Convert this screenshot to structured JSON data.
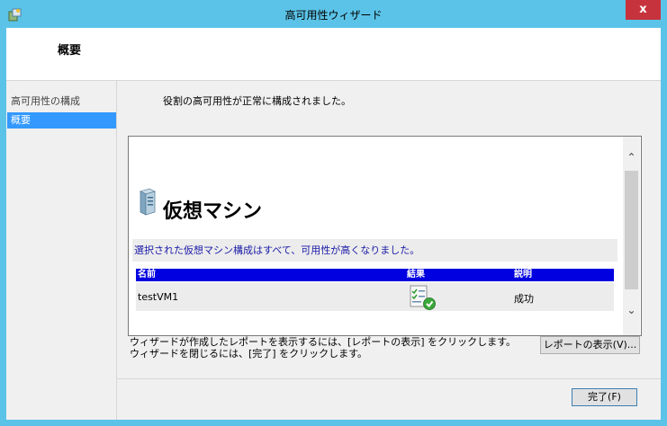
{
  "window": {
    "title": "高可用性ウィザード",
    "close_label": "x"
  },
  "header": {
    "title": "概要"
  },
  "sidebar": {
    "items": [
      {
        "label": "高可用性の構成"
      },
      {
        "label": "概要"
      }
    ]
  },
  "main": {
    "status_message": "役割の高可用性が正常に構成されました。",
    "report": {
      "heading": "仮想マシン",
      "summary": "選択された仮想マシン構成はすべて、可用性が高くなりました。",
      "columns": [
        "名前",
        "結果",
        "説明"
      ],
      "rows": [
        {
          "name": "testVM1",
          "result_icon": "success-check-icon",
          "description": "成功"
        }
      ]
    },
    "footer_text_line1": "ウィザードが作成したレポートを表示するには、[レポートの表示] をクリックします。",
    "footer_text_line2": "ウィザードを閉じるには、[完了] をクリックします。",
    "view_report_button": "レポートの表示(V)...",
    "finish_button": "完了(F)"
  },
  "colors": {
    "frame": "#5bc3e8",
    "close": "#c7333d",
    "selected": "#3399ff",
    "table_header": "#0000e0",
    "summary_text": "#1a1aa8"
  }
}
